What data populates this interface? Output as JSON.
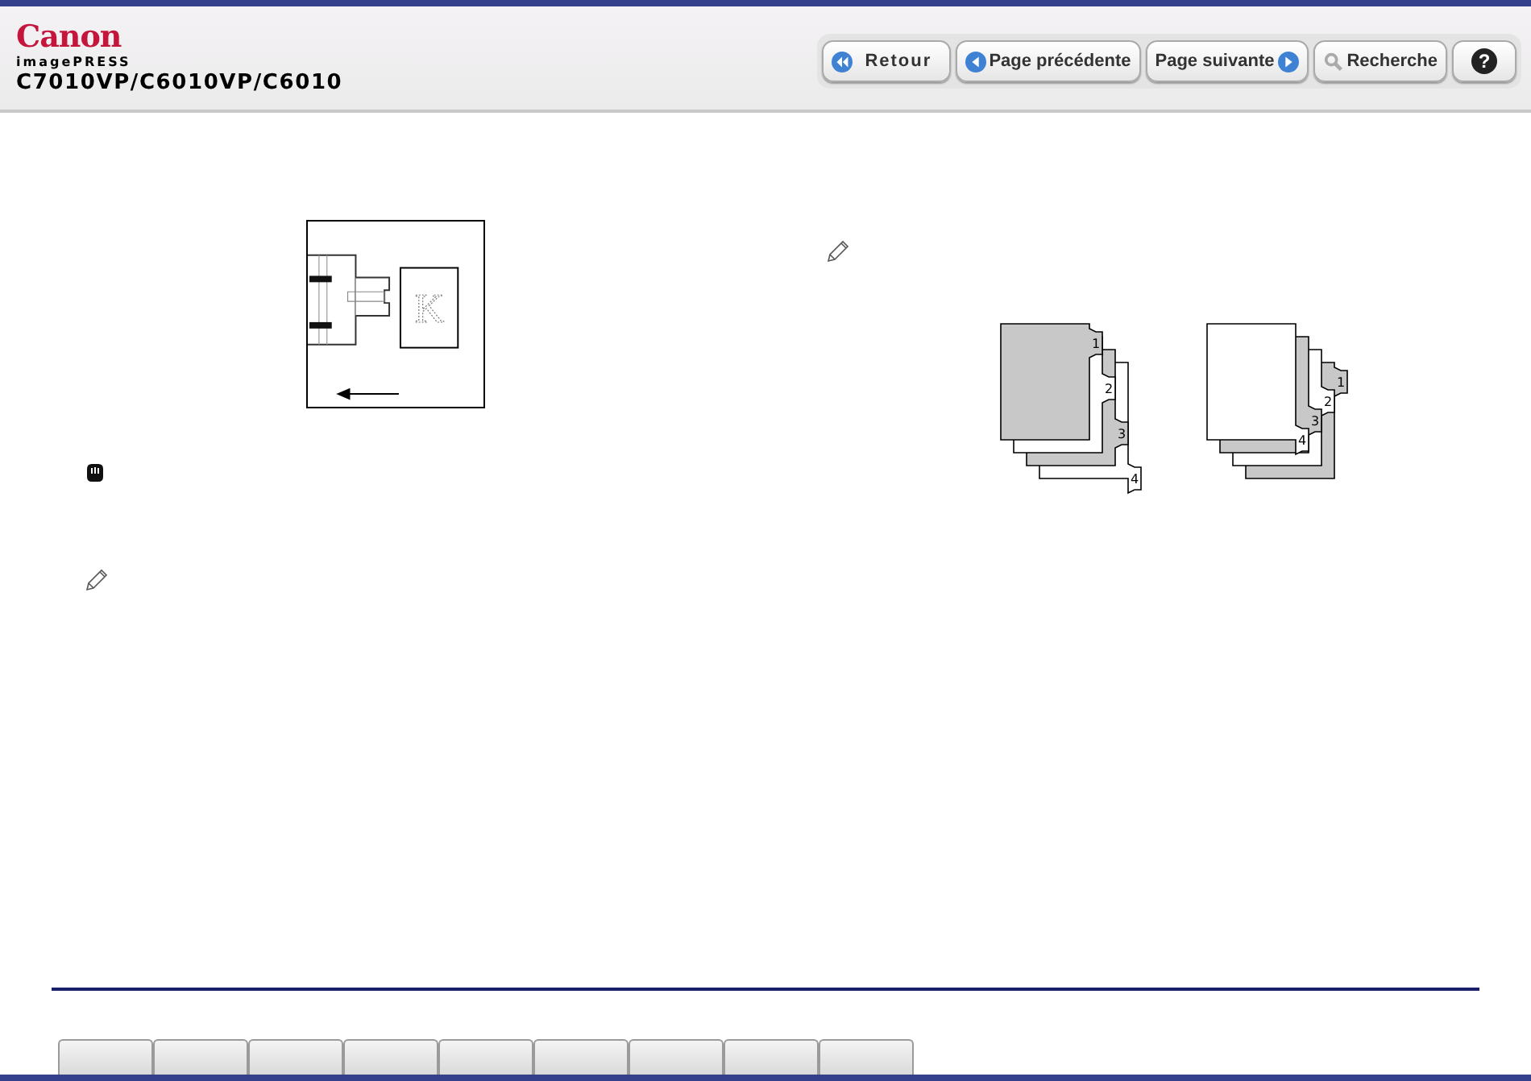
{
  "header": {
    "brand": "Canon",
    "series": "imagePRESS",
    "model": "C7010VP/C6010VP/C6010",
    "buttons": [
      {
        "label": "Retour",
        "kind": "back"
      },
      {
        "label": "Page précédente",
        "kind": "prev"
      },
      {
        "label": "Page suivante",
        "kind": "next"
      },
      {
        "label": "Recherche",
        "kind": "search"
      },
      {
        "label": "?",
        "kind": "help"
      }
    ]
  },
  "feeder_diagram": {
    "original_mark": "K"
  },
  "divider_sets": [
    {
      "kind": "ascending",
      "sheets": [
        {
          "label": "1",
          "shaded": true
        },
        {
          "label": "2",
          "shaded": false
        },
        {
          "label": "3",
          "shaded": true
        },
        {
          "label": "4",
          "shaded": false
        }
      ]
    },
    {
      "kind": "descending",
      "sheets": [
        {
          "label": "4",
          "shaded": false
        },
        {
          "label": "3",
          "shaded": true
        },
        {
          "label": "2",
          "shaded": false
        },
        {
          "label": "1",
          "shaded": true
        }
      ]
    }
  ],
  "footer_tabs": [
    {
      "kind": "blank"
    },
    {
      "kind": "blank"
    },
    {
      "kind": "blank"
    },
    {
      "kind": "blank"
    },
    {
      "kind": "blank"
    },
    {
      "kind": "blank"
    },
    {
      "kind": "blank"
    },
    {
      "kind": "blank"
    },
    {
      "kind": "blank"
    }
  ]
}
